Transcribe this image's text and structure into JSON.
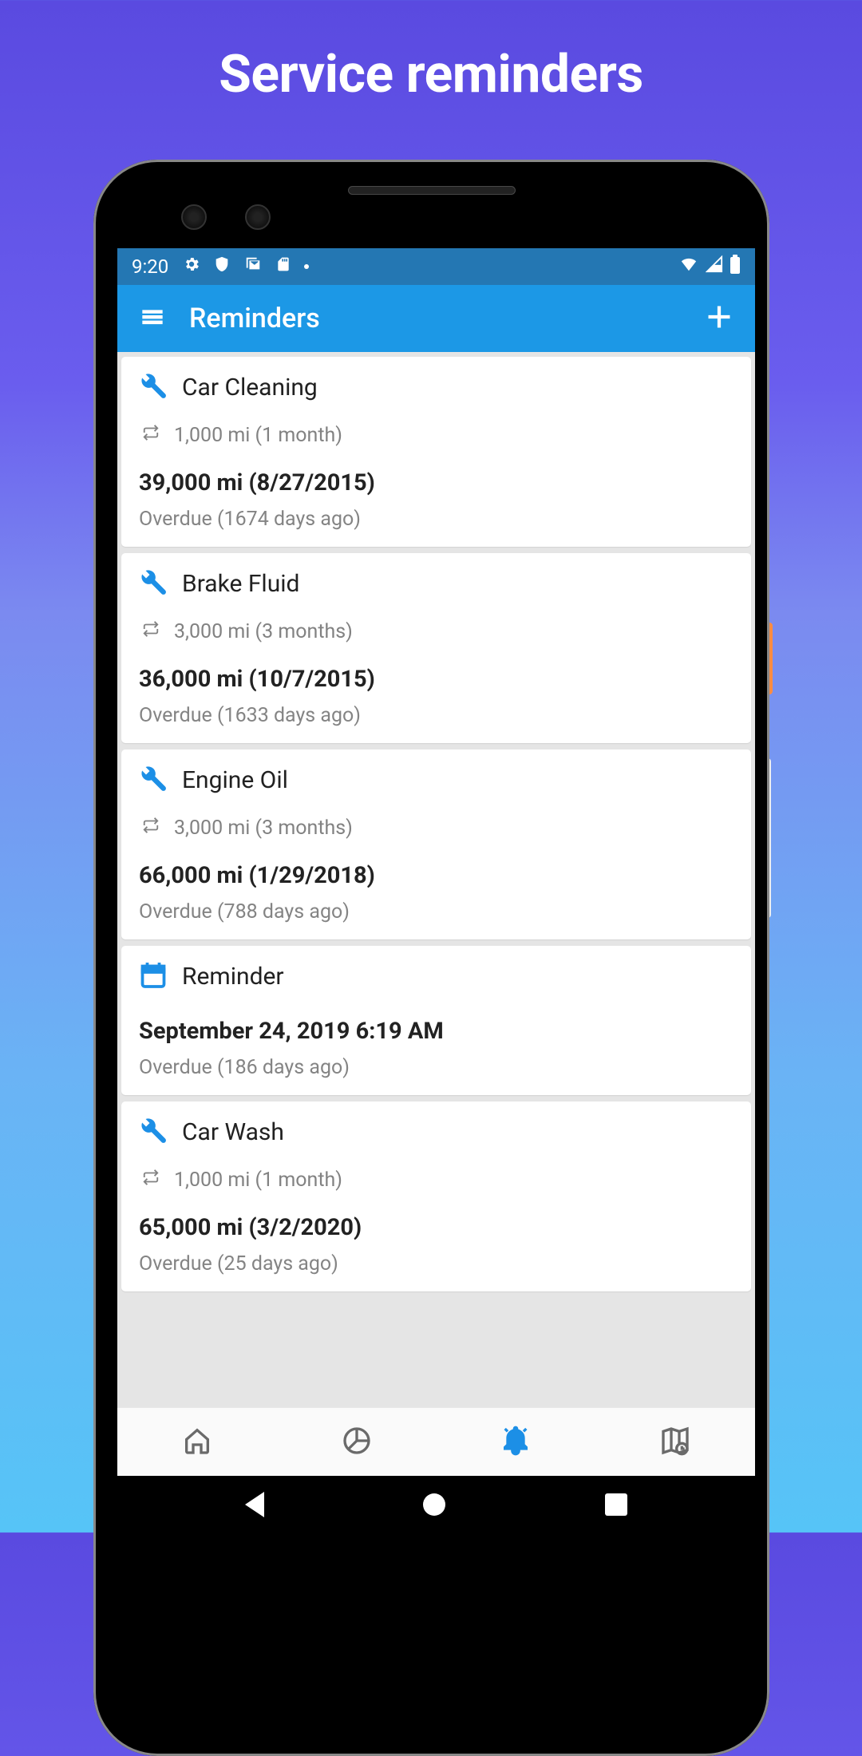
{
  "promo_title": "Service reminders",
  "status": {
    "time": "9:20"
  },
  "app_bar": {
    "title": "Reminders"
  },
  "reminders": [
    {
      "icon": "wrench",
      "title": "Car Cleaning",
      "interval": "1,000 mi (1 month)",
      "due": "39,000 mi (8/27/2015)",
      "overdue": "Overdue (1674 days ago)"
    },
    {
      "icon": "wrench",
      "title": "Brake Fluid",
      "interval": "3,000 mi (3 months)",
      "due": "36,000 mi (10/7/2015)",
      "overdue": "Overdue (1633 days ago)"
    },
    {
      "icon": "wrench",
      "title": "Engine Oil",
      "interval": "3,000 mi (3 months)",
      "due": "66,000 mi (1/29/2018)",
      "overdue": "Overdue (788 days ago)"
    },
    {
      "icon": "calendar",
      "title": "Reminder",
      "interval": null,
      "due": "September 24, 2019 6:19 AM",
      "overdue": "Overdue (186 days ago)"
    },
    {
      "icon": "wrench",
      "title": "Car Wash",
      "interval": "1,000 mi (1 month)",
      "due": "65,000 mi (3/2/2020)",
      "overdue": "Overdue (25 days ago)"
    }
  ],
  "bottom_nav": {
    "items": [
      "home",
      "stats",
      "reminders",
      "routes"
    ],
    "active": 2
  },
  "colors": {
    "accent": "#1c98e6",
    "icon_blue": "#1c8fe6"
  }
}
